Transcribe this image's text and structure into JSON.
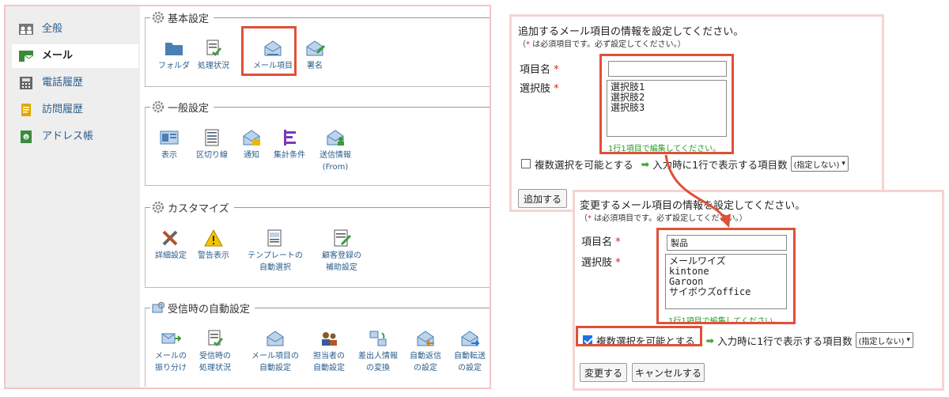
{
  "sidebar": {
    "items": [
      {
        "label": "全般",
        "icon": "person-group-icon"
      },
      {
        "label": "メール",
        "icon": "mail-folder-icon"
      },
      {
        "label": "電話履歴",
        "icon": "phone-icon"
      },
      {
        "label": "訪問履歴",
        "icon": "document-icon"
      },
      {
        "label": "アドレス帳",
        "icon": "address-book-icon"
      }
    ]
  },
  "sections": {
    "basic": {
      "title": "基本設定",
      "tools": [
        "フォルダ",
        "処理状況",
        "メール項目",
        "署名"
      ]
    },
    "general": {
      "title": "一般設定",
      "tools": [
        "表示",
        "区切り線",
        "通知",
        "集計条件",
        "送信情報",
        "(From)"
      ]
    },
    "customize": {
      "title": "カスタマイズ",
      "tools": [
        "詳細設定",
        "警告表示",
        "テンプレートの",
        "自動選択",
        "顧客登録の",
        "補助設定"
      ]
    },
    "auto": {
      "title": "受信時の自動設定",
      "tools": [
        "メールの",
        "振り分け",
        "受信時の",
        "処理状況",
        "メール項目の",
        "自動設定",
        "担当者の",
        "自動設定",
        "差出人情報",
        "の変換",
        "自動返信",
        "の設定",
        "自動転送",
        "の設定"
      ]
    }
  },
  "add_form": {
    "heading": "追加するメール項目の情報を設定してください。",
    "required_mark": "*",
    "required_note": " は必須項目です。必ず設定してください。）",
    "required_open": "（",
    "name_label": "項目名",
    "name_value": "",
    "choices_label": "選択肢",
    "choices_value": "選択肢1\n選択肢2\n選択肢3",
    "hint": "1行1項目で編集してください。",
    "multi_label": "複数選択を可能とする",
    "rows_label": "入力時に1行で表示する項目数",
    "rows_select": "(指定しない)",
    "add_button": "追加する"
  },
  "edit_form": {
    "heading": "変更するメール項目の情報を設定してください。",
    "required_mark": "*",
    "required_note": " は必須項目です。必ず設定してください。）",
    "required_open": "（",
    "name_label": "項目名",
    "name_value": "製品",
    "choices_label": "選択肢",
    "choices_value": "メールワイズ\nkintone\nGaroon\nサイボウズoffice",
    "hint": "1行1項目で編集してください。",
    "multi_label": "複数選択を可能とする",
    "multi_checked": true,
    "rows_label": "入力時に1行で表示する項目数",
    "rows_select": "(指定しない)",
    "change_button": "変更する",
    "cancel_button": "キャンセルする"
  },
  "colors": {
    "highlight": "#e05038",
    "panel_border": "#f3c6c6",
    "link": "#2a5d8a",
    "hint": "#2a9a2a",
    "required": "#e02020"
  }
}
